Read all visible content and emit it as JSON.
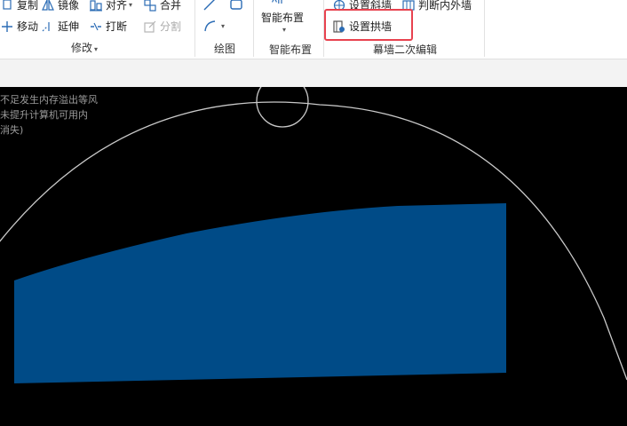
{
  "ribbon": {
    "modify": {
      "copy": "复制",
      "mirror": "镜像",
      "align": "对齐",
      "merge": "合并",
      "move": "移动",
      "extend": "延伸",
      "break": "打断",
      "split": "分割",
      "group_label": "修改"
    },
    "draw": {
      "group_label": "绘图"
    },
    "smart": {
      "layout_button": "智能布置",
      "group_label": "智能布置"
    },
    "curtain": {
      "set_slope": "设置斜墙",
      "judge_wall": "判断内外墙",
      "set_arch": "设置拱墙",
      "group_label": "幕墙二次编辑"
    }
  },
  "canvas": {
    "notice_lines": [
      "不足发生内存溢出等风",
      "未提升计算机可用内",
      "消失)"
    ],
    "background": "#000000",
    "shape_color": "#004b87",
    "highlight_color": "#e8424f"
  }
}
